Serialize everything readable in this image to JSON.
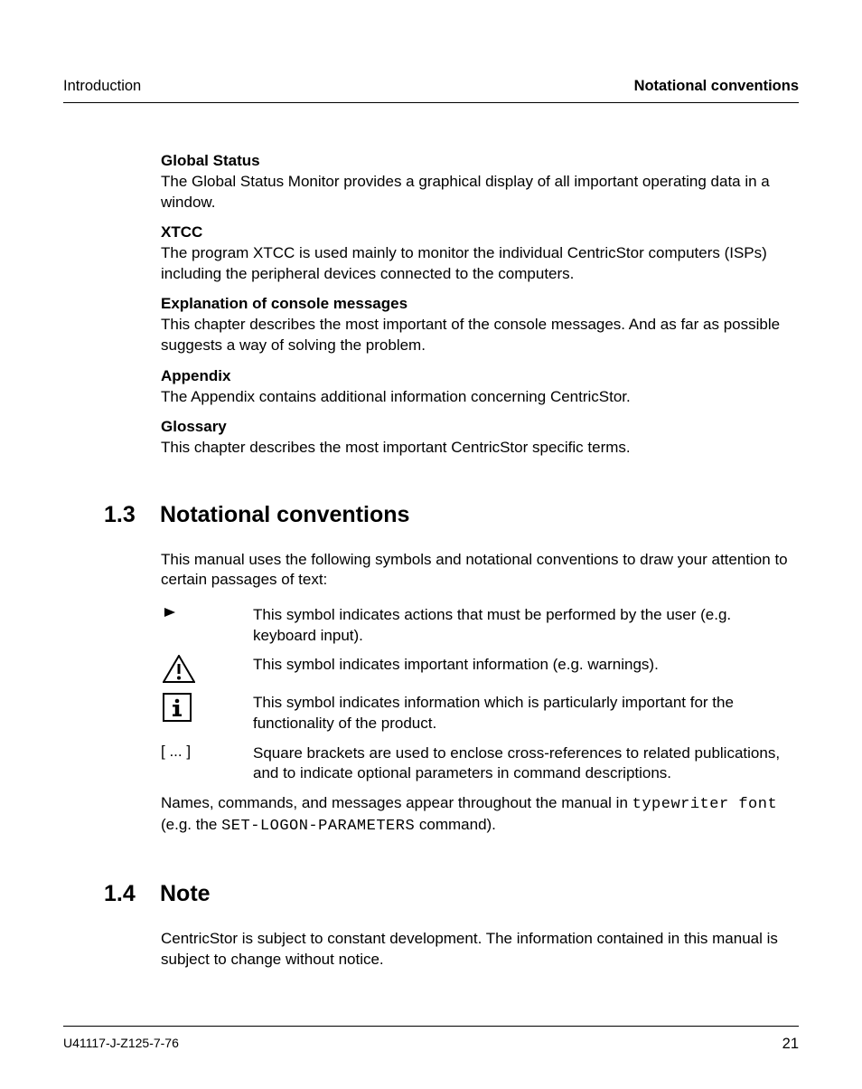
{
  "header": {
    "left": "Introduction",
    "right": "Notational conventions"
  },
  "subsections": [
    {
      "heading": "Global Status",
      "text": "The Global Status Monitor provides a graphical display of all important operating data in a window."
    },
    {
      "heading": "XTCC",
      "text": "The program XTCC is used mainly to monitor the individual CentricStor computers (ISPs) including the peripheral devices connected to the computers."
    },
    {
      "heading": "Explanation of console messages",
      "text": "This chapter describes the most important of the console messages. And as far as possible suggests a way of solving the problem."
    },
    {
      "heading": "Appendix",
      "text": "The Appendix contains additional information concerning CentricStor."
    },
    {
      "heading": "Glossary",
      "text": "This chapter describes the most important CentricStor specific terms."
    }
  ],
  "section13": {
    "number": "1.3",
    "title": "Notational conventions",
    "intro": "This manual uses the following symbols and notational conventions to draw your attention to certain passages of text:"
  },
  "conventions": [
    {
      "desc": "This symbol indicates actions that must be performed by the user (e.g. keyboard input)."
    },
    {
      "desc": "This symbol indicates important information (e.g. warnings)."
    },
    {
      "desc": "This symbol indicates information which is particularly important for the functionality of the product."
    },
    {
      "desc": "Square brackets are used to enclose cross-references to related publications, and to indicate optional parameters in command descriptions."
    }
  ],
  "bracketSymbol": "[ ... ]",
  "typewriterPara": {
    "prefix": "Names, commands, and messages appear throughout the manual in ",
    "tw1": "typewriter font",
    "middle": " (e.g. the ",
    "tw2": "SET-LOGON-PARAMETERS",
    "suffix": " command)."
  },
  "section14": {
    "number": "1.4",
    "title": "Note",
    "text": "CentricStor is subject to constant development. The information contained in this manual is subject to change without notice."
  },
  "footer": {
    "left": "U41117-J-Z125-7-76",
    "right": "21"
  }
}
